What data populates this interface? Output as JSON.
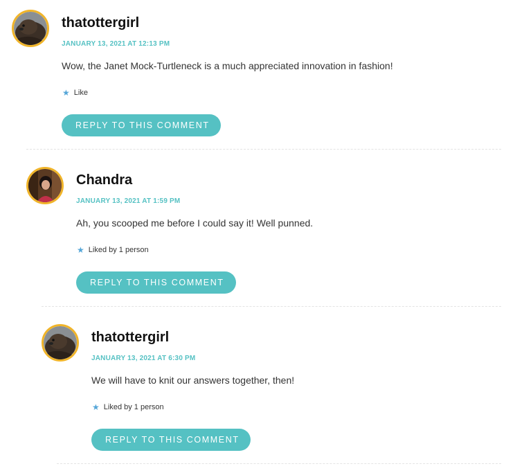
{
  "comments": [
    {
      "author": "thatottergirl",
      "date": "JANUARY 13, 2021 AT 12:13 PM",
      "text": "Wow, the Janet Mock-Turtleneck is a much appreciated innovation in fashion!",
      "like_label": "Like",
      "reply_label": "REPLY TO THIS COMMENT",
      "avatar_icon": "otter-avatar"
    },
    {
      "author": "Chandra",
      "date": "JANUARY 13, 2021 AT 1:59 PM",
      "text": "Ah, you scooped me before I could say it! Well punned.",
      "like_label": "Liked by 1 person",
      "reply_label": "REPLY TO THIS COMMENT",
      "avatar_icon": "person-avatar"
    },
    {
      "author": "thatottergirl",
      "date": "JANUARY 13, 2021 AT 6:30 PM",
      "text": "We will have to knit our answers together, then!",
      "like_label": "Liked by 1 person",
      "reply_label": "REPLY TO THIS COMMENT",
      "avatar_icon": "otter-avatar"
    }
  ],
  "colors": {
    "accent": "#55c1c3",
    "avatar_border": "#f0b429",
    "star": "#55a6d8"
  }
}
